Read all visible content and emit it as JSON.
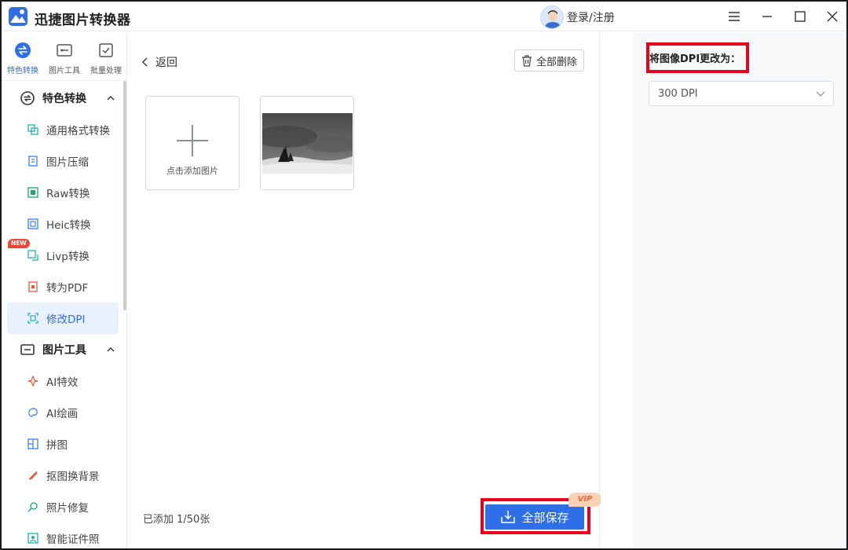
{
  "app": {
    "title": "迅捷图片转换器",
    "login_label": "登录/注册"
  },
  "sidebar": {
    "top_tabs": [
      {
        "label": "特色转换",
        "icon": "swap-icon",
        "active": true
      },
      {
        "label": "图片工具",
        "icon": "image-tool-icon",
        "active": false
      },
      {
        "label": "批量处理",
        "icon": "batch-icon",
        "active": false
      }
    ],
    "group1": {
      "label": "特色转换",
      "items": [
        {
          "label": "通用格式转换",
          "icon": "format-convert-icon"
        },
        {
          "label": "图片压缩",
          "icon": "compress-icon"
        },
        {
          "label": "Raw转换",
          "icon": "raw-icon"
        },
        {
          "label": "Heic转换",
          "icon": "heic-icon"
        },
        {
          "label": "Livp转换",
          "icon": "livp-icon",
          "badge": "NEW"
        },
        {
          "label": "转为PDF",
          "icon": "pdf-icon"
        },
        {
          "label": "修改DPI",
          "icon": "dpi-icon",
          "active": true
        }
      ]
    },
    "group2": {
      "label": "图片工具",
      "items": [
        {
          "label": "AI特效",
          "icon": "ai-effect-icon"
        },
        {
          "label": "AI绘画",
          "icon": "ai-paint-icon"
        },
        {
          "label": "拼图",
          "icon": "collage-icon"
        },
        {
          "label": "抠图换背景",
          "icon": "cutout-icon"
        },
        {
          "label": "照片修复",
          "icon": "repair-icon"
        },
        {
          "label": "智能证件照",
          "icon": "id-photo-icon"
        }
      ]
    }
  },
  "main": {
    "back_label": "返回",
    "delete_all_label": "全部删除",
    "add_image_label": "点击添加图片",
    "count_text": "已添加 1/50张",
    "save_all_label": "全部保存",
    "vip_label": "VIP"
  },
  "right_panel": {
    "dpi_label": "将图像DPI更改为：",
    "dpi_value": "300 DPI"
  },
  "colors": {
    "accent": "#2e6fe8",
    "highlight_box": "#e8001c",
    "active_bg": "#e9f1ff"
  }
}
